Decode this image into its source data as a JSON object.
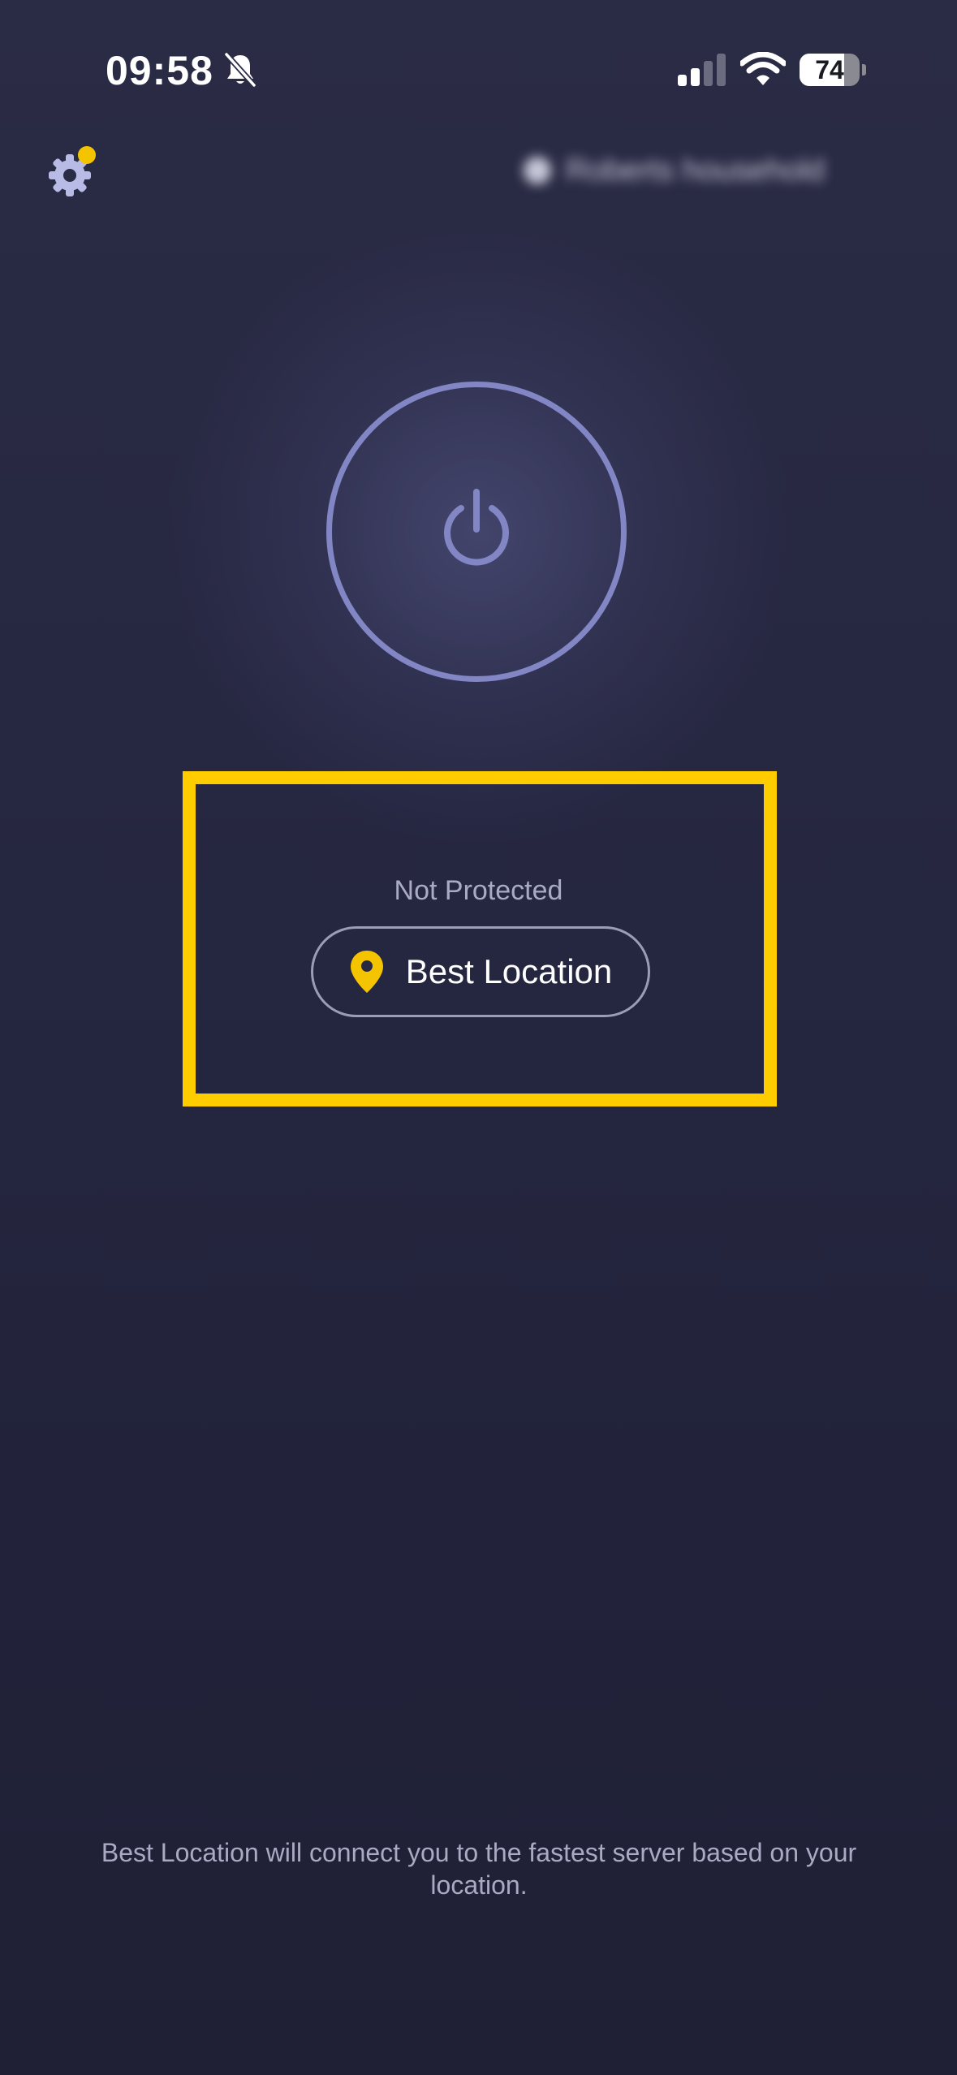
{
  "status_bar": {
    "time": "09:58",
    "battery_level": "74",
    "battery_fraction": 0.74,
    "icons": [
      "bell-off-icon",
      "signal-icon",
      "wifi-icon",
      "battery-icon"
    ]
  },
  "top_bar": {
    "settings_icon": "gear-icon",
    "settings_badge_color": "#f5c400",
    "account_label": "Roberts household"
  },
  "power": {
    "icon": "power-icon",
    "ring_color": "#8286c4"
  },
  "connection": {
    "status": "Not Protected",
    "location_label": "Best Location",
    "location_icon": "map-pin-icon",
    "pin_color": "#f5c400"
  },
  "highlight_color": "#ffcc00",
  "footer": {
    "note": "Best Location will connect you to the fastest server based on your location."
  }
}
